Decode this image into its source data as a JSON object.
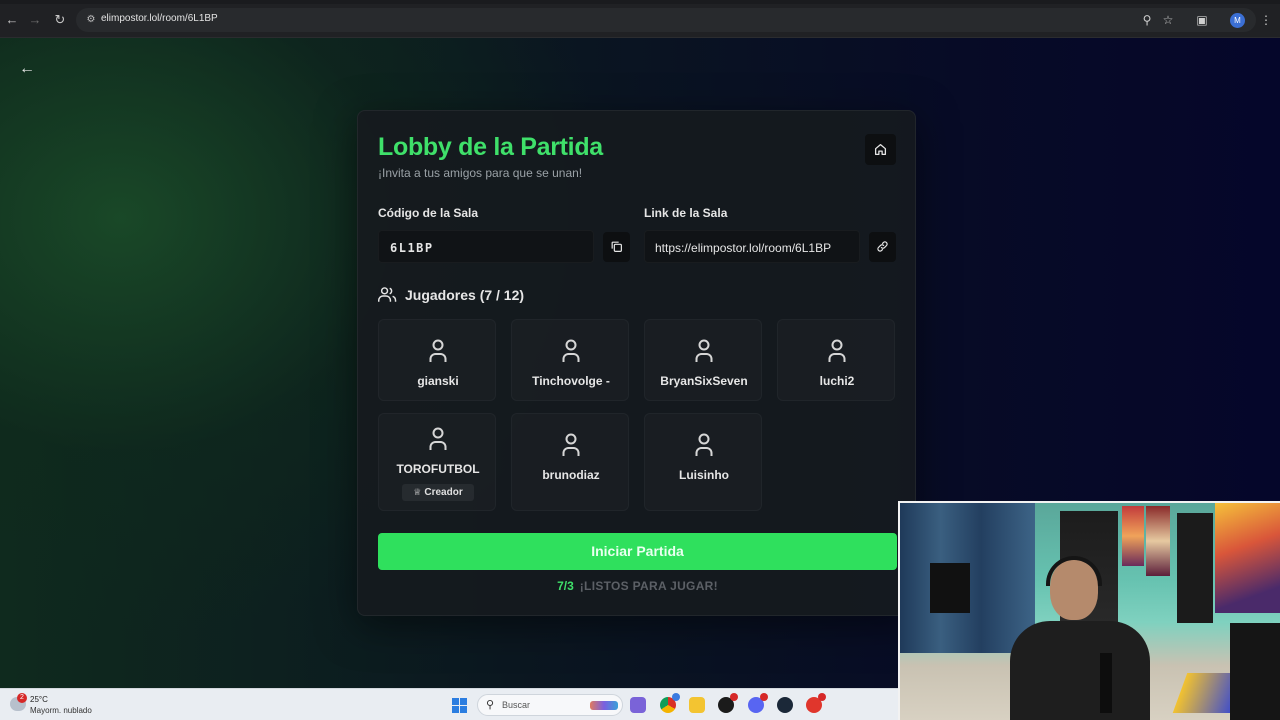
{
  "browser": {
    "url": "elimpostor.lol/room/6L1BP",
    "profile_initial": "M"
  },
  "lobby": {
    "title": "Lobby de la Partida",
    "subtitle": "¡Invita a tus amigos para que se unan!",
    "room_code_label": "Código de la Sala",
    "room_code": "6L1BP",
    "room_link_label": "Link de la Sala",
    "room_link": "https://elimpostor.lol/room/6L1BP",
    "players_header": "Jugadores (7 / 12)",
    "players": [
      {
        "name": "gianski"
      },
      {
        "name": "Tinchovolge -"
      },
      {
        "name": "BryanSixSeven"
      },
      {
        "name": "luchi2"
      },
      {
        "name": "TOROFUTBOL",
        "badge": "Creador"
      },
      {
        "name": "brunodiaz"
      },
      {
        "name": "Luisinho"
      }
    ],
    "start_button": "Iniciar Partida",
    "ready_count": "7/3",
    "ready_text": "¡LISTOS PARA JUGAR!"
  },
  "taskbar": {
    "weather_badge": "2",
    "weather_temp": "25°C",
    "weather_desc": "Mayorm. nublado",
    "search_placeholder": "Buscar"
  },
  "colors": {
    "accent": "#3fe06a",
    "button": "#2fe05d",
    "card_bg": "#16191d",
    "page_bg_left": "#0f2a1e",
    "page_bg_right": "#05062a"
  }
}
